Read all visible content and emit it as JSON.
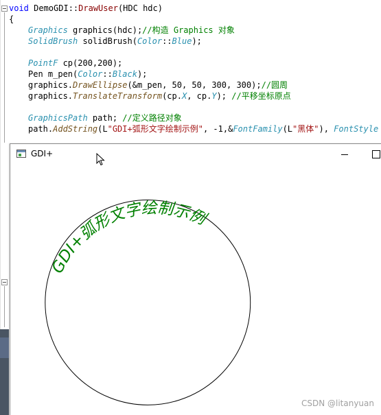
{
  "editor": {
    "lines": [
      {
        "id": "l1",
        "indent": 0,
        "parts": [
          {
            "c": "kw",
            "t": "void"
          },
          {
            "c": "",
            "t": " DemoGDI::"
          },
          {
            "c": "fn",
            "t": "DrawUser"
          },
          {
            "c": "",
            "t": "(HDC hdc)"
          }
        ]
      },
      {
        "id": "l2",
        "indent": 0,
        "parts": [
          {
            "c": "",
            "t": "{"
          }
        ]
      },
      {
        "id": "l3",
        "indent": 1,
        "parts": [
          {
            "c": "ty",
            "t": "Graphics"
          },
          {
            "c": "",
            "t": " graphics(hdc);"
          },
          {
            "c": "cmt",
            "t": "//构造 Graphics 对象"
          }
        ]
      },
      {
        "id": "l4",
        "indent": 1,
        "parts": [
          {
            "c": "ty",
            "t": "SolidBrush"
          },
          {
            "c": "",
            "t": " solidBrush("
          },
          {
            "c": "cls",
            "t": "Color"
          },
          {
            "c": "",
            "t": "::"
          },
          {
            "c": "cls",
            "t": "Blue"
          },
          {
            "c": "",
            "t": ");"
          }
        ]
      },
      {
        "id": "l5",
        "indent": 0,
        "parts": []
      },
      {
        "id": "l6",
        "indent": 1,
        "parts": [
          {
            "c": "ty",
            "t": "PointF"
          },
          {
            "c": "",
            "t": " cp(200,200);"
          }
        ]
      },
      {
        "id": "l7",
        "indent": 1,
        "parts": [
          {
            "c": "",
            "t": "Pen m_pen("
          },
          {
            "c": "cls",
            "t": "Color"
          },
          {
            "c": "",
            "t": "::"
          },
          {
            "c": "cls",
            "t": "Black"
          },
          {
            "c": "",
            "t": ");"
          }
        ]
      },
      {
        "id": "l8",
        "indent": 1,
        "parts": [
          {
            "c": "",
            "t": "graphics."
          },
          {
            "c": "mth",
            "t": "DrawEllipse"
          },
          {
            "c": "",
            "t": "(&m_pen, 50, 50, 300, 300);"
          },
          {
            "c": "cmt",
            "t": "//圆周"
          }
        ]
      },
      {
        "id": "l9",
        "indent": 1,
        "parts": [
          {
            "c": "",
            "t": "graphics."
          },
          {
            "c": "mth",
            "t": "TranslateTransform"
          },
          {
            "c": "",
            "t": "(cp."
          },
          {
            "c": "cls",
            "t": "X"
          },
          {
            "c": "",
            "t": ", cp."
          },
          {
            "c": "cls",
            "t": "Y"
          },
          {
            "c": "",
            "t": "); "
          },
          {
            "c": "cmt",
            "t": "//平移坐标原点"
          }
        ]
      },
      {
        "id": "l10",
        "indent": 0,
        "parts": []
      },
      {
        "id": "l11",
        "indent": 1,
        "parts": [
          {
            "c": "ty",
            "t": "GraphicsPath"
          },
          {
            "c": "",
            "t": " path; "
          },
          {
            "c": "cmt",
            "t": "//定义路径对象"
          }
        ]
      },
      {
        "id": "l12",
        "indent": 1,
        "parts": [
          {
            "c": "",
            "t": "path."
          },
          {
            "c": "mth",
            "t": "AddString"
          },
          {
            "c": "",
            "t": "(L"
          },
          {
            "c": "str",
            "t": "\"GDI+弧形文字绘制示例\""
          },
          {
            "c": "",
            "t": ", -1,&"
          },
          {
            "c": "ty",
            "t": "FontFamily"
          },
          {
            "c": "",
            "t": "(L"
          },
          {
            "c": "str",
            "t": "\"黑体\""
          },
          {
            "c": "",
            "t": "), "
          },
          {
            "c": "ty",
            "t": "FontStyle"
          }
        ]
      }
    ]
  },
  "window": {
    "title": "GDI+",
    "icon": "app-window-icon",
    "minimize_icon": "minimize-icon",
    "maximize_icon": "maximize-icon"
  },
  "drawing": {
    "arc_text": "GDI+弧形文字绘制示例",
    "text_color": "#008000",
    "circle_stroke": "#000000"
  },
  "cursor_icon": "mouse-pointer-icon",
  "watermark": "CSDN @litanyuan"
}
